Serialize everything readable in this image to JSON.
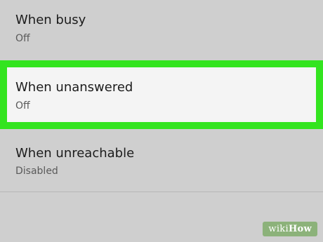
{
  "settings": {
    "items": [
      {
        "title": "When busy",
        "status": "Off"
      },
      {
        "title": "When unanswered",
        "status": "Off",
        "highlight_color": "#33e41f"
      },
      {
        "title": "When unreachable",
        "status": "Disabled"
      }
    ]
  },
  "watermark": {
    "brand_part1": "wiki",
    "brand_part2": "How"
  }
}
